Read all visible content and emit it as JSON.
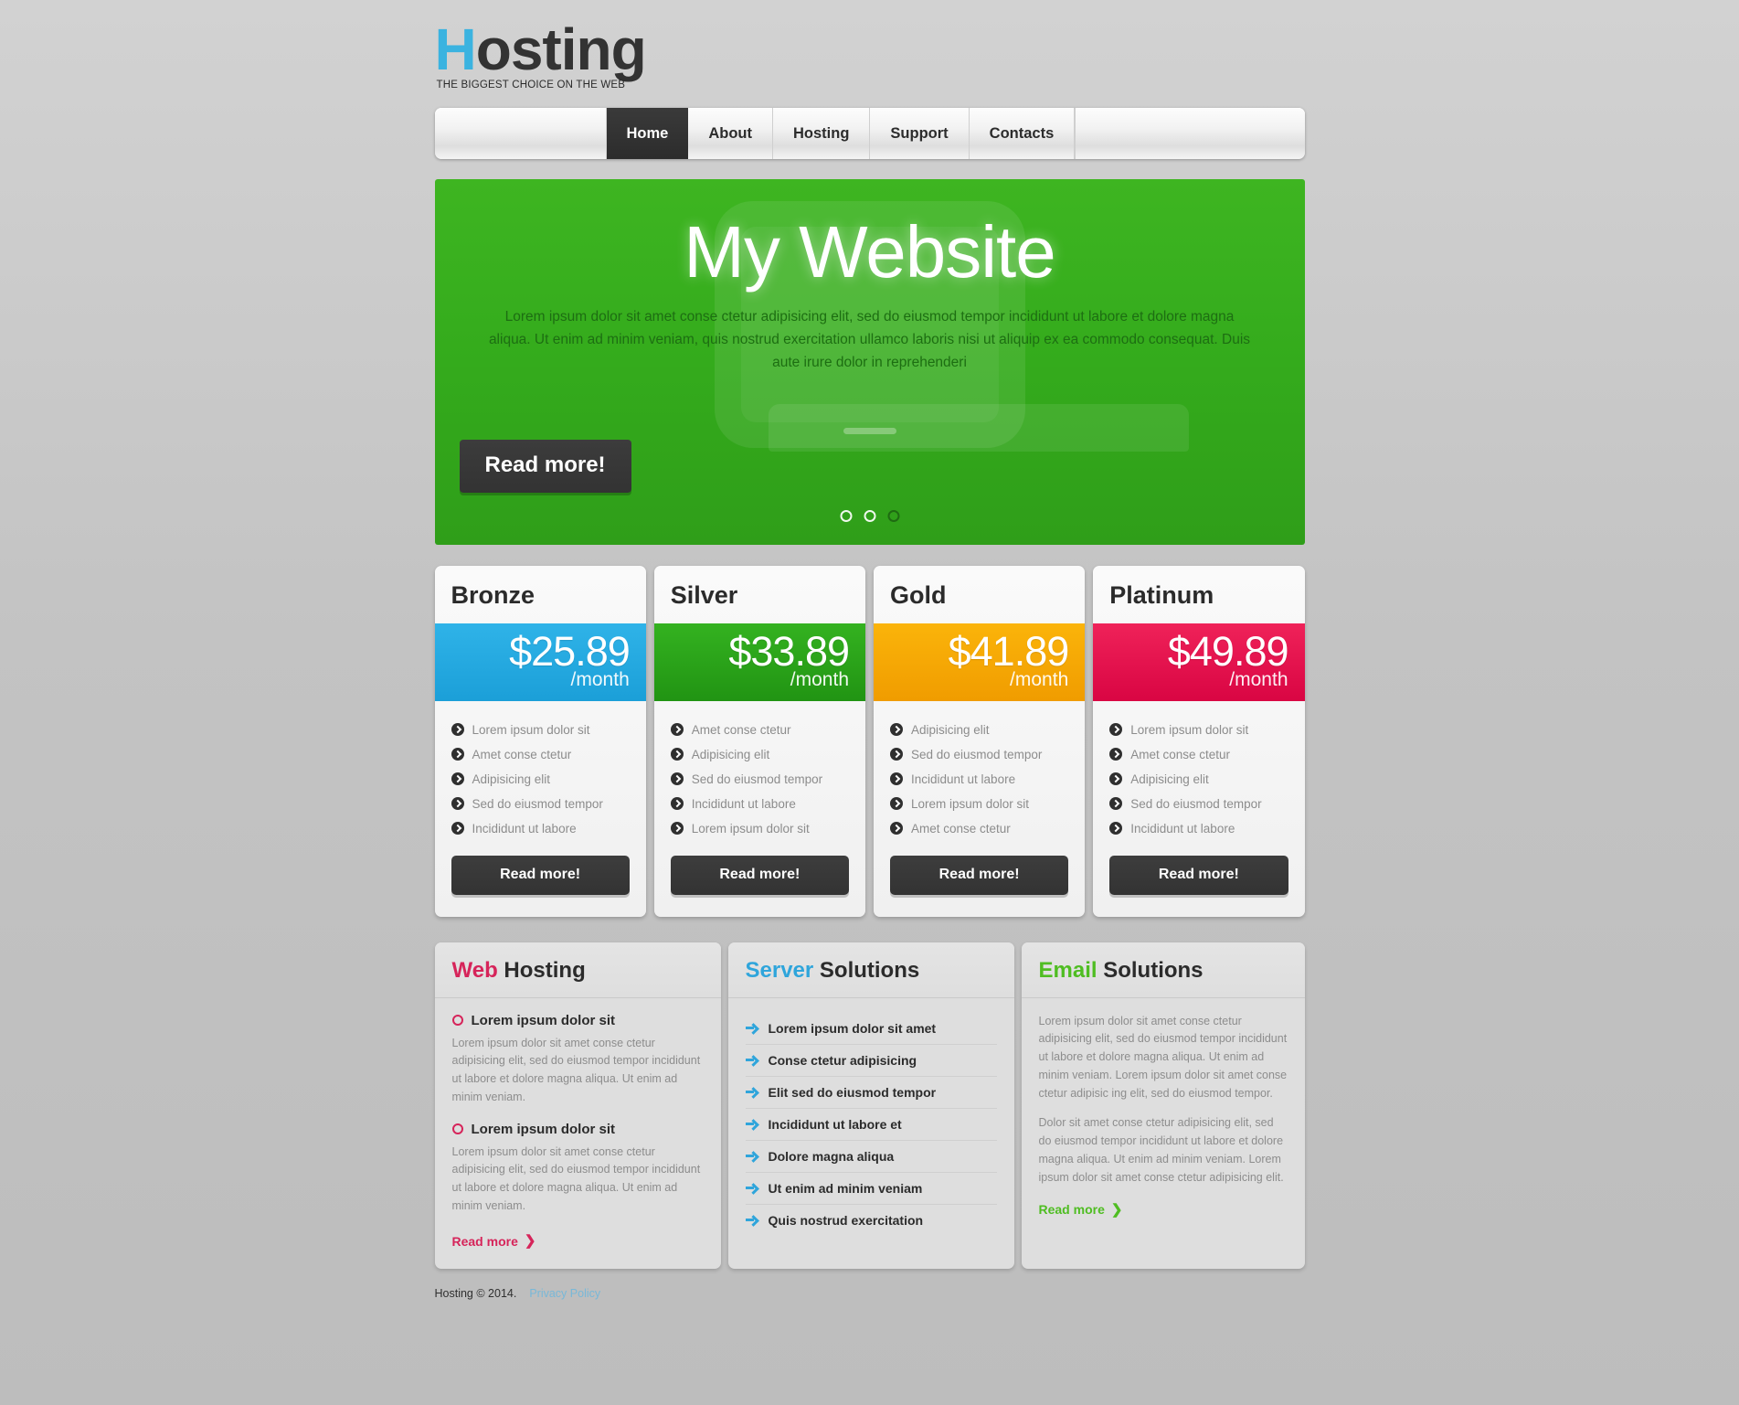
{
  "brand": {
    "logo_first": "H",
    "logo_rest": "osting",
    "tagline": "THE BIGGEST CHOICE ON THE WEB"
  },
  "nav": {
    "items": [
      {
        "label": "Home",
        "active": true
      },
      {
        "label": "About",
        "active": false
      },
      {
        "label": "Hosting",
        "active": false
      },
      {
        "label": "Support",
        "active": false
      },
      {
        "label": "Contacts",
        "active": false
      }
    ]
  },
  "hero": {
    "title": "My Website",
    "text": "Lorem ipsum dolor sit amet conse ctetur adipisicing elit, sed do eiusmod tempor incididunt ut labore et dolore magna aliqua. Ut enim ad minim veniam, quis nostrud exercitation ullamco laboris nisi ut aliquip ex ea commodo consequat. Duis aute irure dolor in reprehenderi",
    "button": "Read more!",
    "slides": 3,
    "active_slide": 3,
    "bg_color": "#34ab1c"
  },
  "pricing": {
    "plans": [
      {
        "name": "Bronze",
        "price": "$25.89",
        "per": "/month",
        "color": "#22a7e0",
        "features": [
          "Lorem ipsum dolor sit",
          "Amet conse ctetur",
          "Adipisicing elit",
          "Sed do eiusmod tempor",
          "Incididunt ut labore"
        ],
        "button": "Read more!"
      },
      {
        "name": "Silver",
        "price": "$33.89",
        "per": "/month",
        "color": "#2ba31a",
        "features": [
          "Amet conse ctetur",
          "Adipisicing elit",
          "Sed do eiusmod tempor",
          "Incididunt ut labore",
          "Lorem ipsum dolor sit"
        ],
        "button": "Read more!"
      },
      {
        "name": "Gold",
        "price": "$41.89",
        "per": "/month",
        "color": "#f5a800",
        "features": [
          "Adipisicing elit",
          "Sed do eiusmod tempor",
          "Incididunt ut labore",
          "Lorem ipsum dolor sit",
          "Amet conse ctetur"
        ],
        "button": "Read more!"
      },
      {
        "name": "Platinum",
        "price": "$49.89",
        "per": "/month",
        "color": "#e5134f",
        "features": [
          "Lorem ipsum dolor sit",
          "Amet conse ctetur",
          "Adipisicing elit",
          "Sed do eiusmod tempor",
          "Incididunt ut labore"
        ],
        "button": "Read more!"
      }
    ]
  },
  "columns": {
    "web": {
      "head_accent": "Web",
      "head_rest": " Hosting",
      "accent_color": "#d6245a",
      "blocks": [
        {
          "title": "Lorem ipsum dolor sit",
          "text": "Lorem ipsum dolor sit amet conse ctetur adipisicing elit, sed do eiusmod tempor incididunt ut labore et dolore magna aliqua. Ut enim ad minim veniam."
        },
        {
          "title": "Lorem ipsum dolor sit",
          "text": "Lorem ipsum dolor sit amet conse ctetur adipisicing elit, sed do eiusmod tempor incididunt ut labore et dolore magna aliqua. Ut enim ad minim veniam."
        }
      ],
      "read_more": "Read more"
    },
    "server": {
      "head_accent": "Server",
      "head_rest": " Solutions",
      "accent_color": "#2fa5db",
      "items": [
        "Lorem ipsum dolor sit amet",
        "Conse ctetur adipisicing",
        "Elit sed do eiusmod tempor",
        "Incididunt ut labore et",
        "Dolore magna aliqua",
        "Ut enim ad minim veniam",
        "Quis nostrud exercitation"
      ]
    },
    "email": {
      "head_accent": "Email",
      "head_rest": " Solutions",
      "accent_color": "#4fbd22",
      "paragraphs": [
        "Lorem ipsum dolor sit amet conse ctetur adipisicing elit, sed do eiusmod tempor incididunt ut labore et dolore magna aliqua. Ut enim ad minim veniam. Lorem ipsum dolor sit amet conse ctetur adipisic ing elit, sed do eiusmod tempor.",
        "Dolor sit amet conse ctetur adipisicing elit, sed do eiusmod tempor incididunt ut labore et dolore magna aliqua. Ut enim ad minim veniam. Lorem ipsum dolor sit amet conse ctetur adipisicing elit."
      ],
      "read_more": "Read more"
    }
  },
  "footer": {
    "copyright": "Hosting © 2014.",
    "privacy_label": "Privacy Policy"
  }
}
